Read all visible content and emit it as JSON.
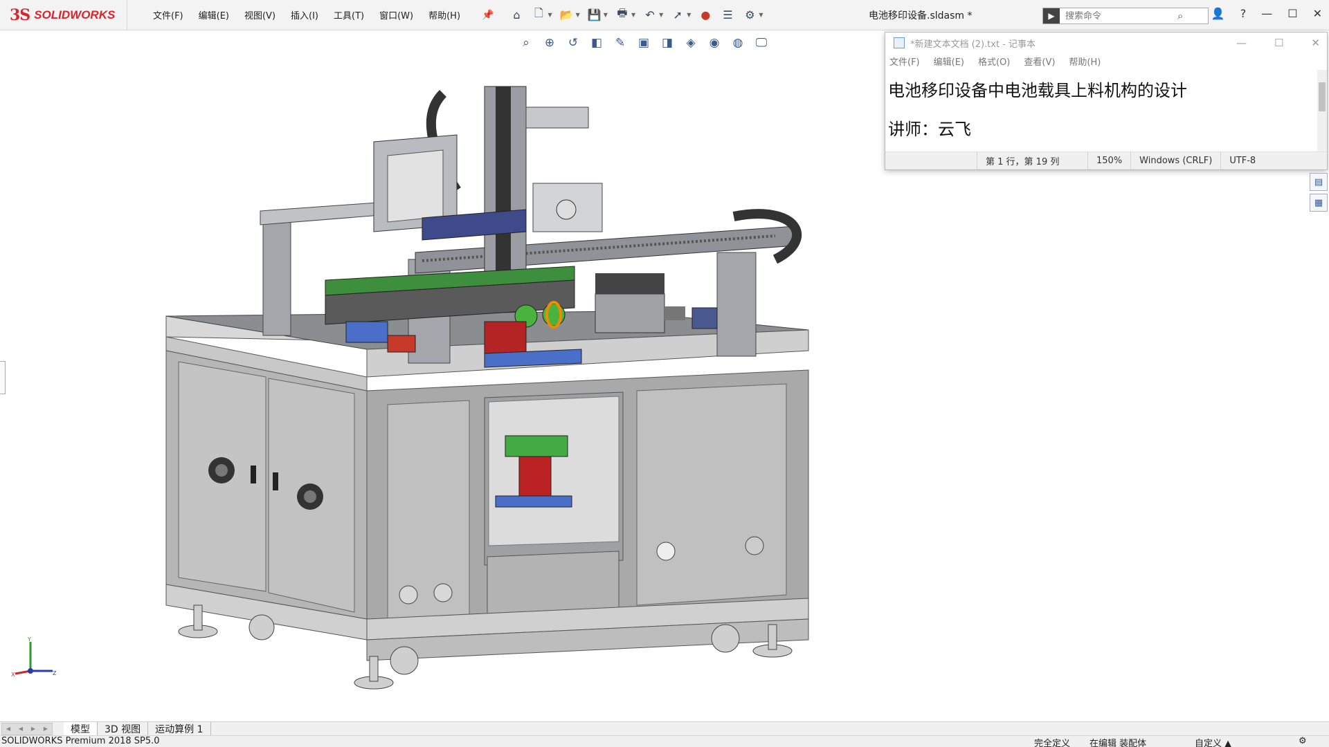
{
  "app": {
    "brand_mark": "3S",
    "brand_name": "SOLIDWORKS",
    "document_title": "电池移印设备.sldasm *"
  },
  "menus": [
    "文件(F)",
    "编辑(E)",
    "视图(V)",
    "插入(I)",
    "工具(T)",
    "窗口(W)",
    "帮助(H)"
  ],
  "search": {
    "placeholder": "搜索命令"
  },
  "notepad": {
    "title": "*新建文本文档 (2).txt - 记事本",
    "menu": [
      "文件(F)",
      "编辑(E)",
      "格式(O)",
      "查看(V)",
      "帮助(H)"
    ],
    "line1": "电池移印设备中电池载具上料机构的设计",
    "line2": "讲师：云飞",
    "status_position": "第 1 行，第 19 列",
    "status_zoom": "150%",
    "status_eol": "Windows (CRLF)",
    "status_encoding": "UTF-8"
  },
  "bottom_tabs": [
    "模型",
    "3D 视图",
    "运动算例 1"
  ],
  "status": {
    "product": "SOLIDWORKS Premium 2018 SP5.0",
    "defined": "完全定义",
    "editing": "在编辑 装配体",
    "units": "自定义",
    "units_caret": "▲"
  },
  "triad": {
    "y": "Y",
    "x": "X",
    "z": "Z"
  },
  "icons": {
    "home": "home-icon",
    "new": "new-document-icon",
    "open": "open-icon",
    "save": "save-icon",
    "print": "print-icon",
    "undo": "undo-icon",
    "select": "select-icon",
    "rebuild": "rebuild-icon",
    "file_props": "file-properties-icon",
    "options": "options-icon"
  },
  "colors": {
    "brand": "#d7262e",
    "accent": "#2f6fdb"
  }
}
